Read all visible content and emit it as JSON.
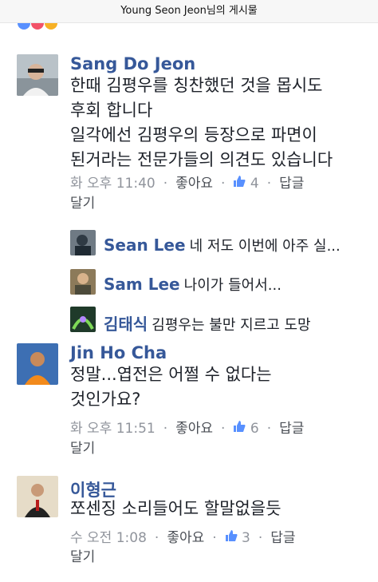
{
  "header": {
    "title": "Young Seon Jeon님의 게시물"
  },
  "comments": [
    {
      "author": "Sang Do Jeon",
      "lines": [
        "한때 김평우를 칭찬했던 것을 몹시도",
        "후회 합니다",
        "일각에선 김평우의 등장으로 파면이",
        "된거라는 전문가들의 의견도 있습니다"
      ],
      "time": "화 오후 11:40",
      "like": "좋아요",
      "likes": "4",
      "reply": "답글",
      "more": "달기",
      "replies": [
        {
          "author": "Sean Lee",
          "text": "네 저도 이번에 아주 실..."
        },
        {
          "author": "Sam Lee",
          "text": "나이가 들어서..."
        },
        {
          "author": "김태식",
          "text": "김평우는 불만 지르고 도망"
        }
      ]
    },
    {
      "author": "Jin Ho Cha",
      "lines": [
        "정말...엽전은 어쩔 수 없다는",
        "것인가요?"
      ],
      "time": "화 오후 11:51",
      "like": "좋아요",
      "likes": "6",
      "reply": "답글",
      "more": "달기"
    },
    {
      "author": "이형근",
      "lines": [
        "쪼센징 소리들어도 할말없을듯"
      ],
      "time": "수 오전 1:08",
      "like": "좋아요",
      "likes": "3",
      "reply": "답글",
      "more": "달기"
    }
  ]
}
